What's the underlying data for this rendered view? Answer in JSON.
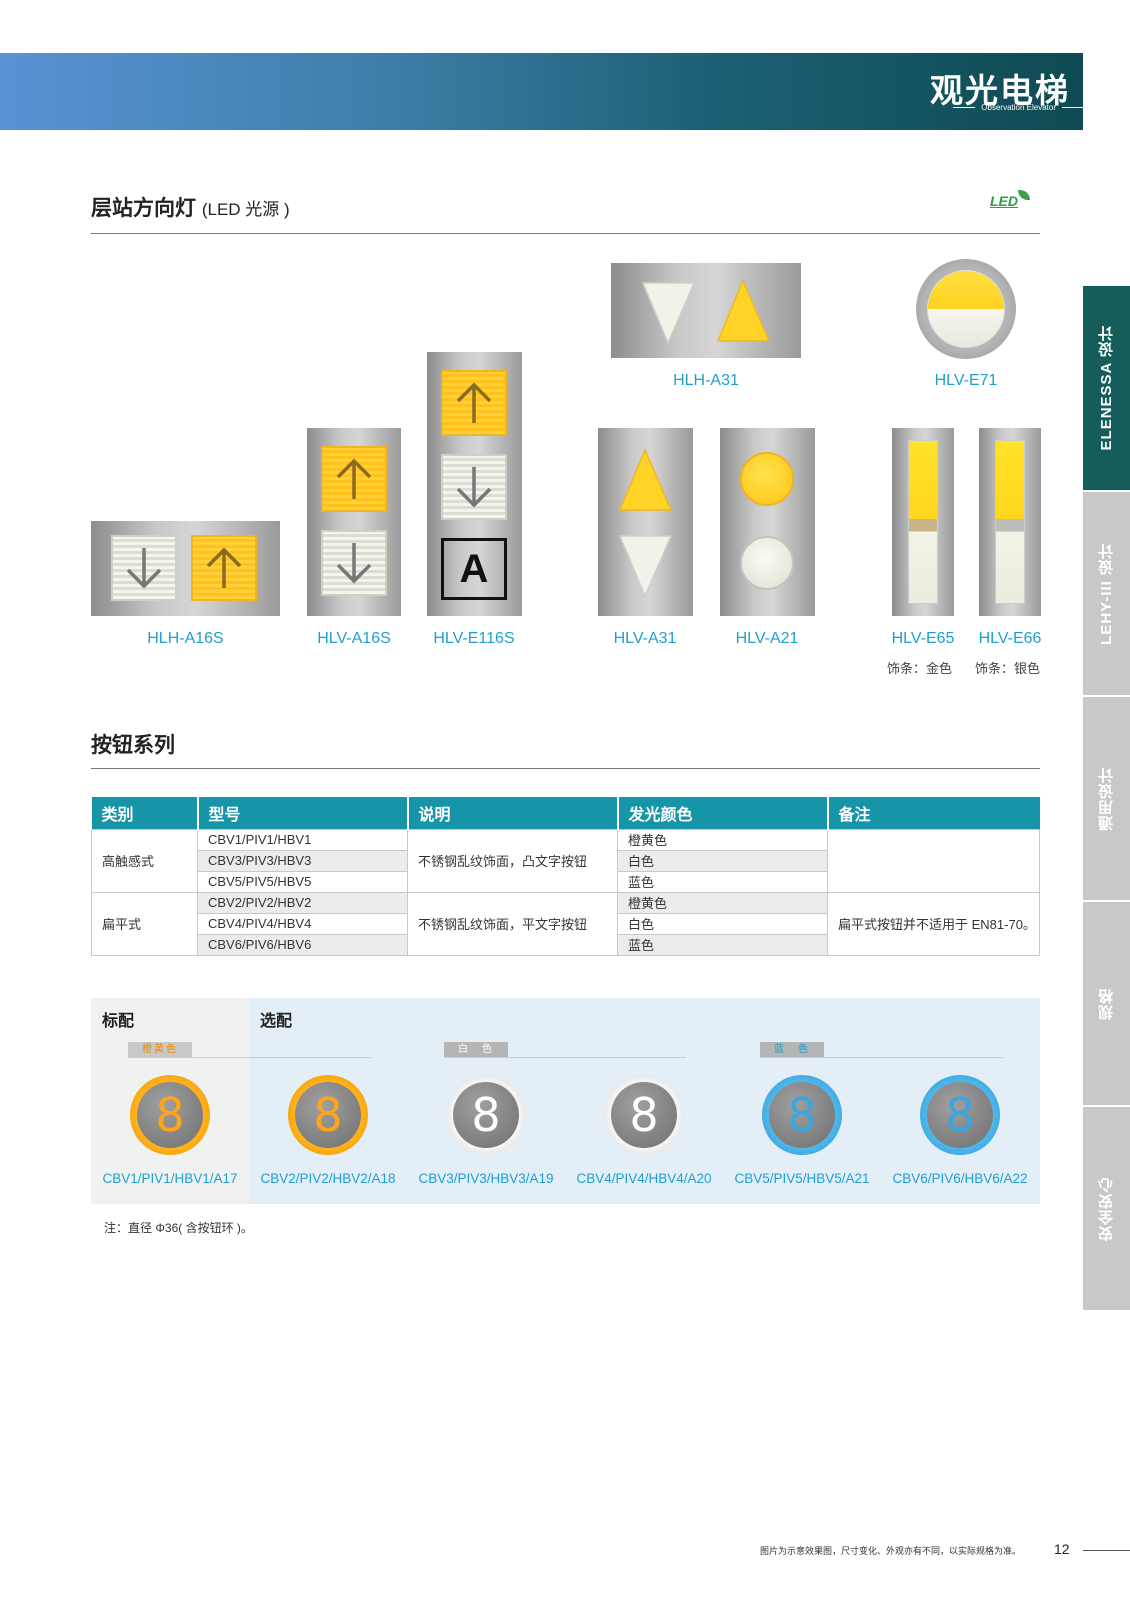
{
  "banner": {
    "title": "观光电梯",
    "subtitle": "Observation Elevator"
  },
  "section1": {
    "title": "层站方向灯",
    "title_suffix": "(LED 光源 )",
    "led_logo": "LED"
  },
  "products": {
    "hlh_a16s": "HLH-A16S",
    "hlv_a16s": "HLV-A16S",
    "hlv_e116s": "HLV-E116S",
    "hlh_a31": "HLH-A31",
    "hlv_e71": "HLV-E71",
    "hlv_a31": "HLV-A31",
    "hlv_a21": "HLV-A21",
    "hlv_e65": "HLV-E65",
    "hlv_e66": "HLV-E66",
    "hlv_e65_note": "饰条：金色",
    "hlv_e66_note": "饰条：银色",
    "e116s_letter": "A"
  },
  "section2": {
    "title": "按钮系列"
  },
  "table": {
    "headers": [
      "类别",
      "型号",
      "说明",
      "发光颜色",
      "备注"
    ],
    "group1": {
      "category": "高触感式",
      "models": [
        "CBV1/PIV1/HBV1",
        "CBV3/PIV3/HBV3",
        "CBV5/PIV5/HBV5"
      ],
      "desc": "不锈钢乱纹饰面，凸文字按钮",
      "colors": [
        "橙黄色",
        "白色",
        "蓝色"
      ],
      "remark": ""
    },
    "group2": {
      "category": "扁平式",
      "models": [
        "CBV2/PIV2/HBV2",
        "CBV4/PIV4/HBV4",
        "CBV6/PIV6/HBV6"
      ],
      "desc": "不锈钢乱纹饰面，平文字按钮",
      "colors": [
        "橙黄色",
        "白色",
        "蓝色"
      ],
      "remark": "扁平式按钮并不适用于 EN81-70。"
    }
  },
  "buttons": {
    "standard_label": "标配",
    "optional_label": "选配",
    "tag_orange": "橙黄色",
    "tag_white": "白　色",
    "tag_blue": "蓝　色",
    "digit": "8",
    "items": [
      "CBV1/PIV1/HBV1/A17",
      "CBV2/PIV2/HBV2/A18",
      "CBV3/PIV3/HBV3/A19",
      "CBV4/PIV4/HBV4/A20",
      "CBV5/PIV5/HBV5/A21",
      "CBV6/PIV6/HBV6/A22"
    ],
    "note": "注：直径 Φ36( 含按钮环 )。"
  },
  "side_tabs": [
    "ELENESSA 设计",
    "LEHY-III 设计",
    "通用设计",
    "规格",
    "安全安心"
  ],
  "footer": {
    "disclaimer": "图片为示意效果图，尺寸变化、外观亦有不同，以实际规格为准。",
    "page": "12"
  },
  "colors": {
    "teal": "#1795a8",
    "dark_teal": "#145d5a",
    "amber": "#ffc21a",
    "caption_blue": "#1f9fd0",
    "blue_ring": "#3aa6e0"
  }
}
